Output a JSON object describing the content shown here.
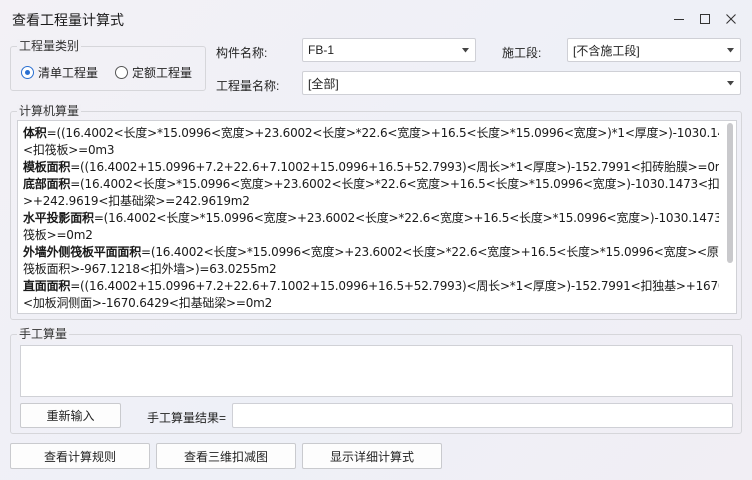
{
  "window": {
    "title": "查看工程量计算式",
    "minimize_icon": "minimize-icon",
    "maximize_icon": "maximize-icon",
    "close_icon": "close-icon"
  },
  "quantity_type": {
    "group_label": "工程量类别",
    "options": [
      {
        "label": "清单工程量",
        "checked": true
      },
      {
        "label": "定额工程量",
        "checked": false
      }
    ]
  },
  "filters": {
    "component_name_label": "构件名称:",
    "component_name_value": "FB-1",
    "construction_stage_label": "施工段:",
    "construction_stage_value": "[不含施工段]",
    "quantity_name_label": "工程量名称:",
    "quantity_name_value": "[全部]"
  },
  "computer_calc": {
    "group_label": "计算机算量",
    "lines": [
      {
        "bold": "体积",
        "text": "=((16.4002<长度>*15.0996<宽度>+23.6002<长度>*22.6<宽度>+16.5<长度>*15.0996<宽度>)*1<厚度>)-1030.1473"
      },
      {
        "bold": "",
        "text": "<扣筏板>=0m3"
      },
      {
        "bold": "模板面积",
        "text": "=((16.4002+15.0996+7.2+22.6+7.1002+15.0996+16.5+52.7993)<周长>*1<厚度>)-152.7991<扣砖胎膜>=0m2"
      },
      {
        "bold": "底部面积",
        "text": "=(16.4002<长度>*15.0996<宽度>+23.6002<长度>*22.6<宽度>+16.5<长度>*15.0996<宽度>)-1030.1473<扣柱墩"
      },
      {
        "bold": "",
        "text": ">+242.9619<扣基础梁>=242.9619m2"
      },
      {
        "bold": "水平投影面积",
        "text": "=(16.4002<长度>*15.0996<宽度>+23.6002<长度>*22.6<宽度>+16.5<长度>*15.0996<宽度>)-1030.1473<扣"
      },
      {
        "bold": "",
        "text": "筏板>=0m2"
      },
      {
        "bold": "外墙外侧筏板平面面积",
        "text": "=(16.4002<长度>*15.0996<宽度>+23.6002<长度>*22.6<宽度>+16.5<长度>*15.0996<宽度><原始"
      },
      {
        "bold": "",
        "text": "筏板面积>-967.1218<扣外墙>)=63.0255m2"
      },
      {
        "bold": "直面面积",
        "text": "=((16.4002+15.0996+7.2+22.6+7.1002+15.0996+16.5+52.7993)<周长>*1<厚度>)-152.7991<扣独基>+1670.6429"
      },
      {
        "bold": "",
        "text": "<加板洞侧面>-1670.6429<扣基础梁>=0m2"
      }
    ]
  },
  "manual_calc": {
    "group_label": "手工算量",
    "reinput_button": "重新输入",
    "result_label": "手工算量结果=",
    "result_value": ""
  },
  "bottom_buttons": {
    "view_rules": "查看计算规则",
    "view_3d": "查看三维扣减图",
    "show_detail": "显示详细计算式"
  },
  "colors": {
    "radio_accent": "#2a6fd1",
    "background": "#f1f0f5"
  }
}
